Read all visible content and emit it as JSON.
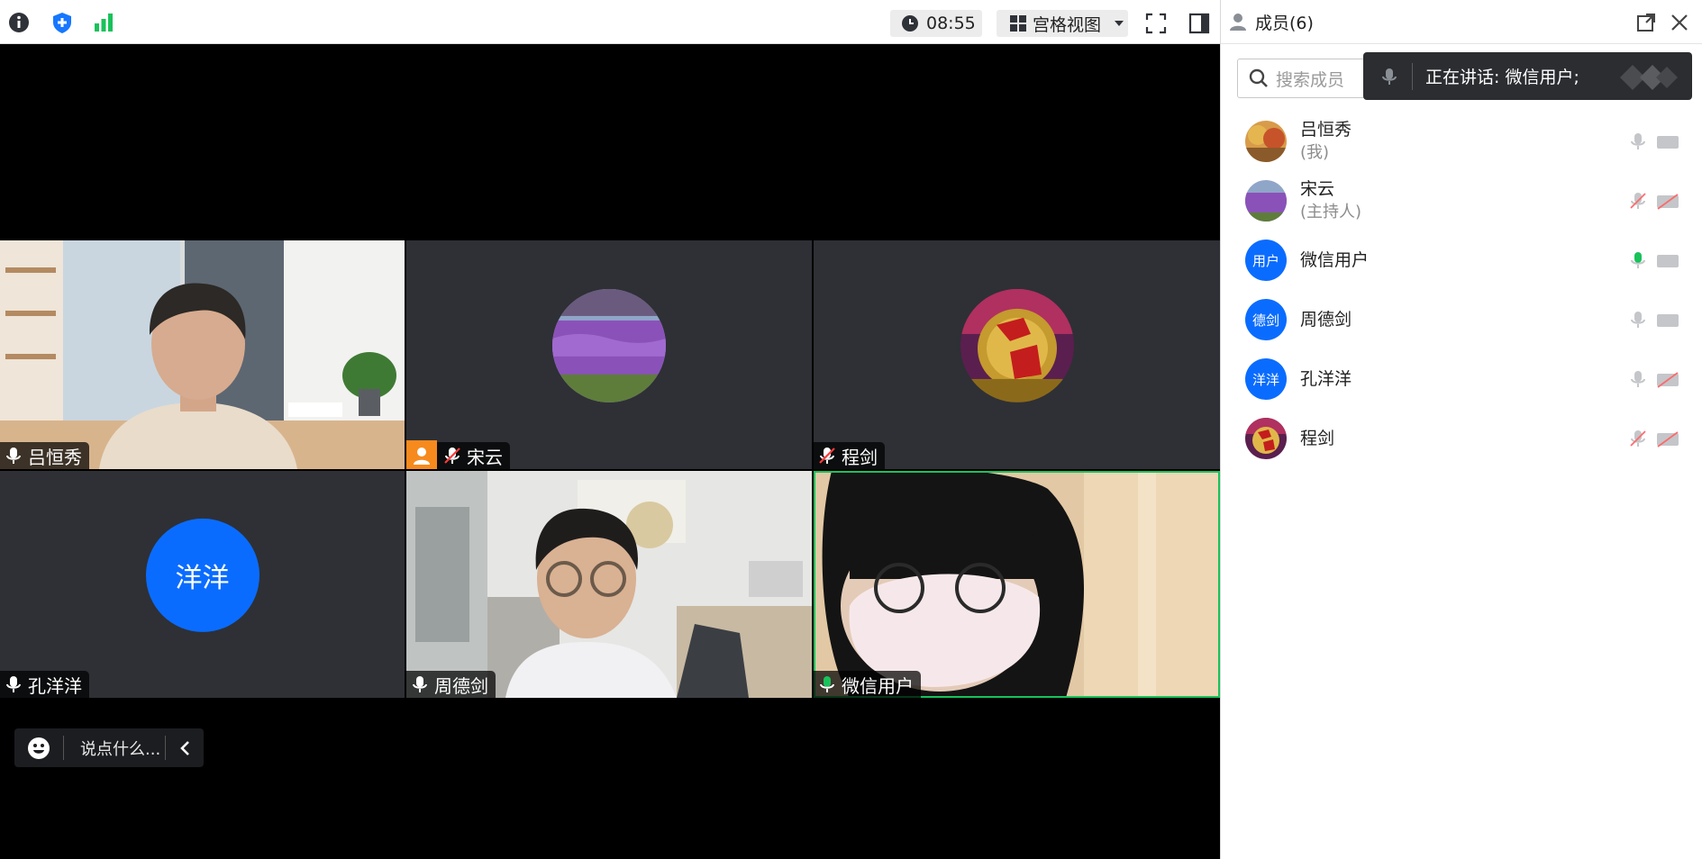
{
  "toolbar": {
    "timer": "08:55",
    "view_label": "宫格视图"
  },
  "tiles": [
    {
      "name": "吕恒秀",
      "mic": "on",
      "type": "video"
    },
    {
      "name": "宋云",
      "mic": "muted",
      "type": "avatar",
      "host": true
    },
    {
      "name": "程剑",
      "mic": "muted",
      "type": "avatar"
    },
    {
      "name": "孔洋洋",
      "mic": "on",
      "type": "text-avatar",
      "avatar_text": "洋洋"
    },
    {
      "name": "周德剑",
      "mic": "on",
      "type": "video"
    },
    {
      "name": "微信用户",
      "mic": "speaking",
      "type": "video"
    }
  ],
  "chat": {
    "placeholder": "说点什么..."
  },
  "side": {
    "title": "成员(6)",
    "search_placeholder": "搜索成员",
    "speaking": "正在讲话: 微信用户;",
    "members": [
      {
        "name": "吕恒秀",
        "role": "(我)",
        "mic": "on",
        "cam": "on"
      },
      {
        "name": "宋云",
        "role": "(主持人)",
        "mic": "muted",
        "cam": "off"
      },
      {
        "name": "微信用户",
        "role": "",
        "avatar_text": "用户",
        "mic": "speaking",
        "cam": "on"
      },
      {
        "name": "周德剑",
        "role": "",
        "avatar_text": "德剑",
        "mic": "on",
        "cam": "on"
      },
      {
        "name": "孔洋洋",
        "role": "",
        "avatar_text": "洋洋",
        "mic": "on",
        "cam": "off"
      },
      {
        "name": "程剑",
        "role": "",
        "mic": "muted",
        "cam": "off"
      }
    ]
  },
  "colors": {
    "accent": "#0a6cff",
    "speaking": "#19c25a",
    "host_badge": "#f78a1d"
  }
}
